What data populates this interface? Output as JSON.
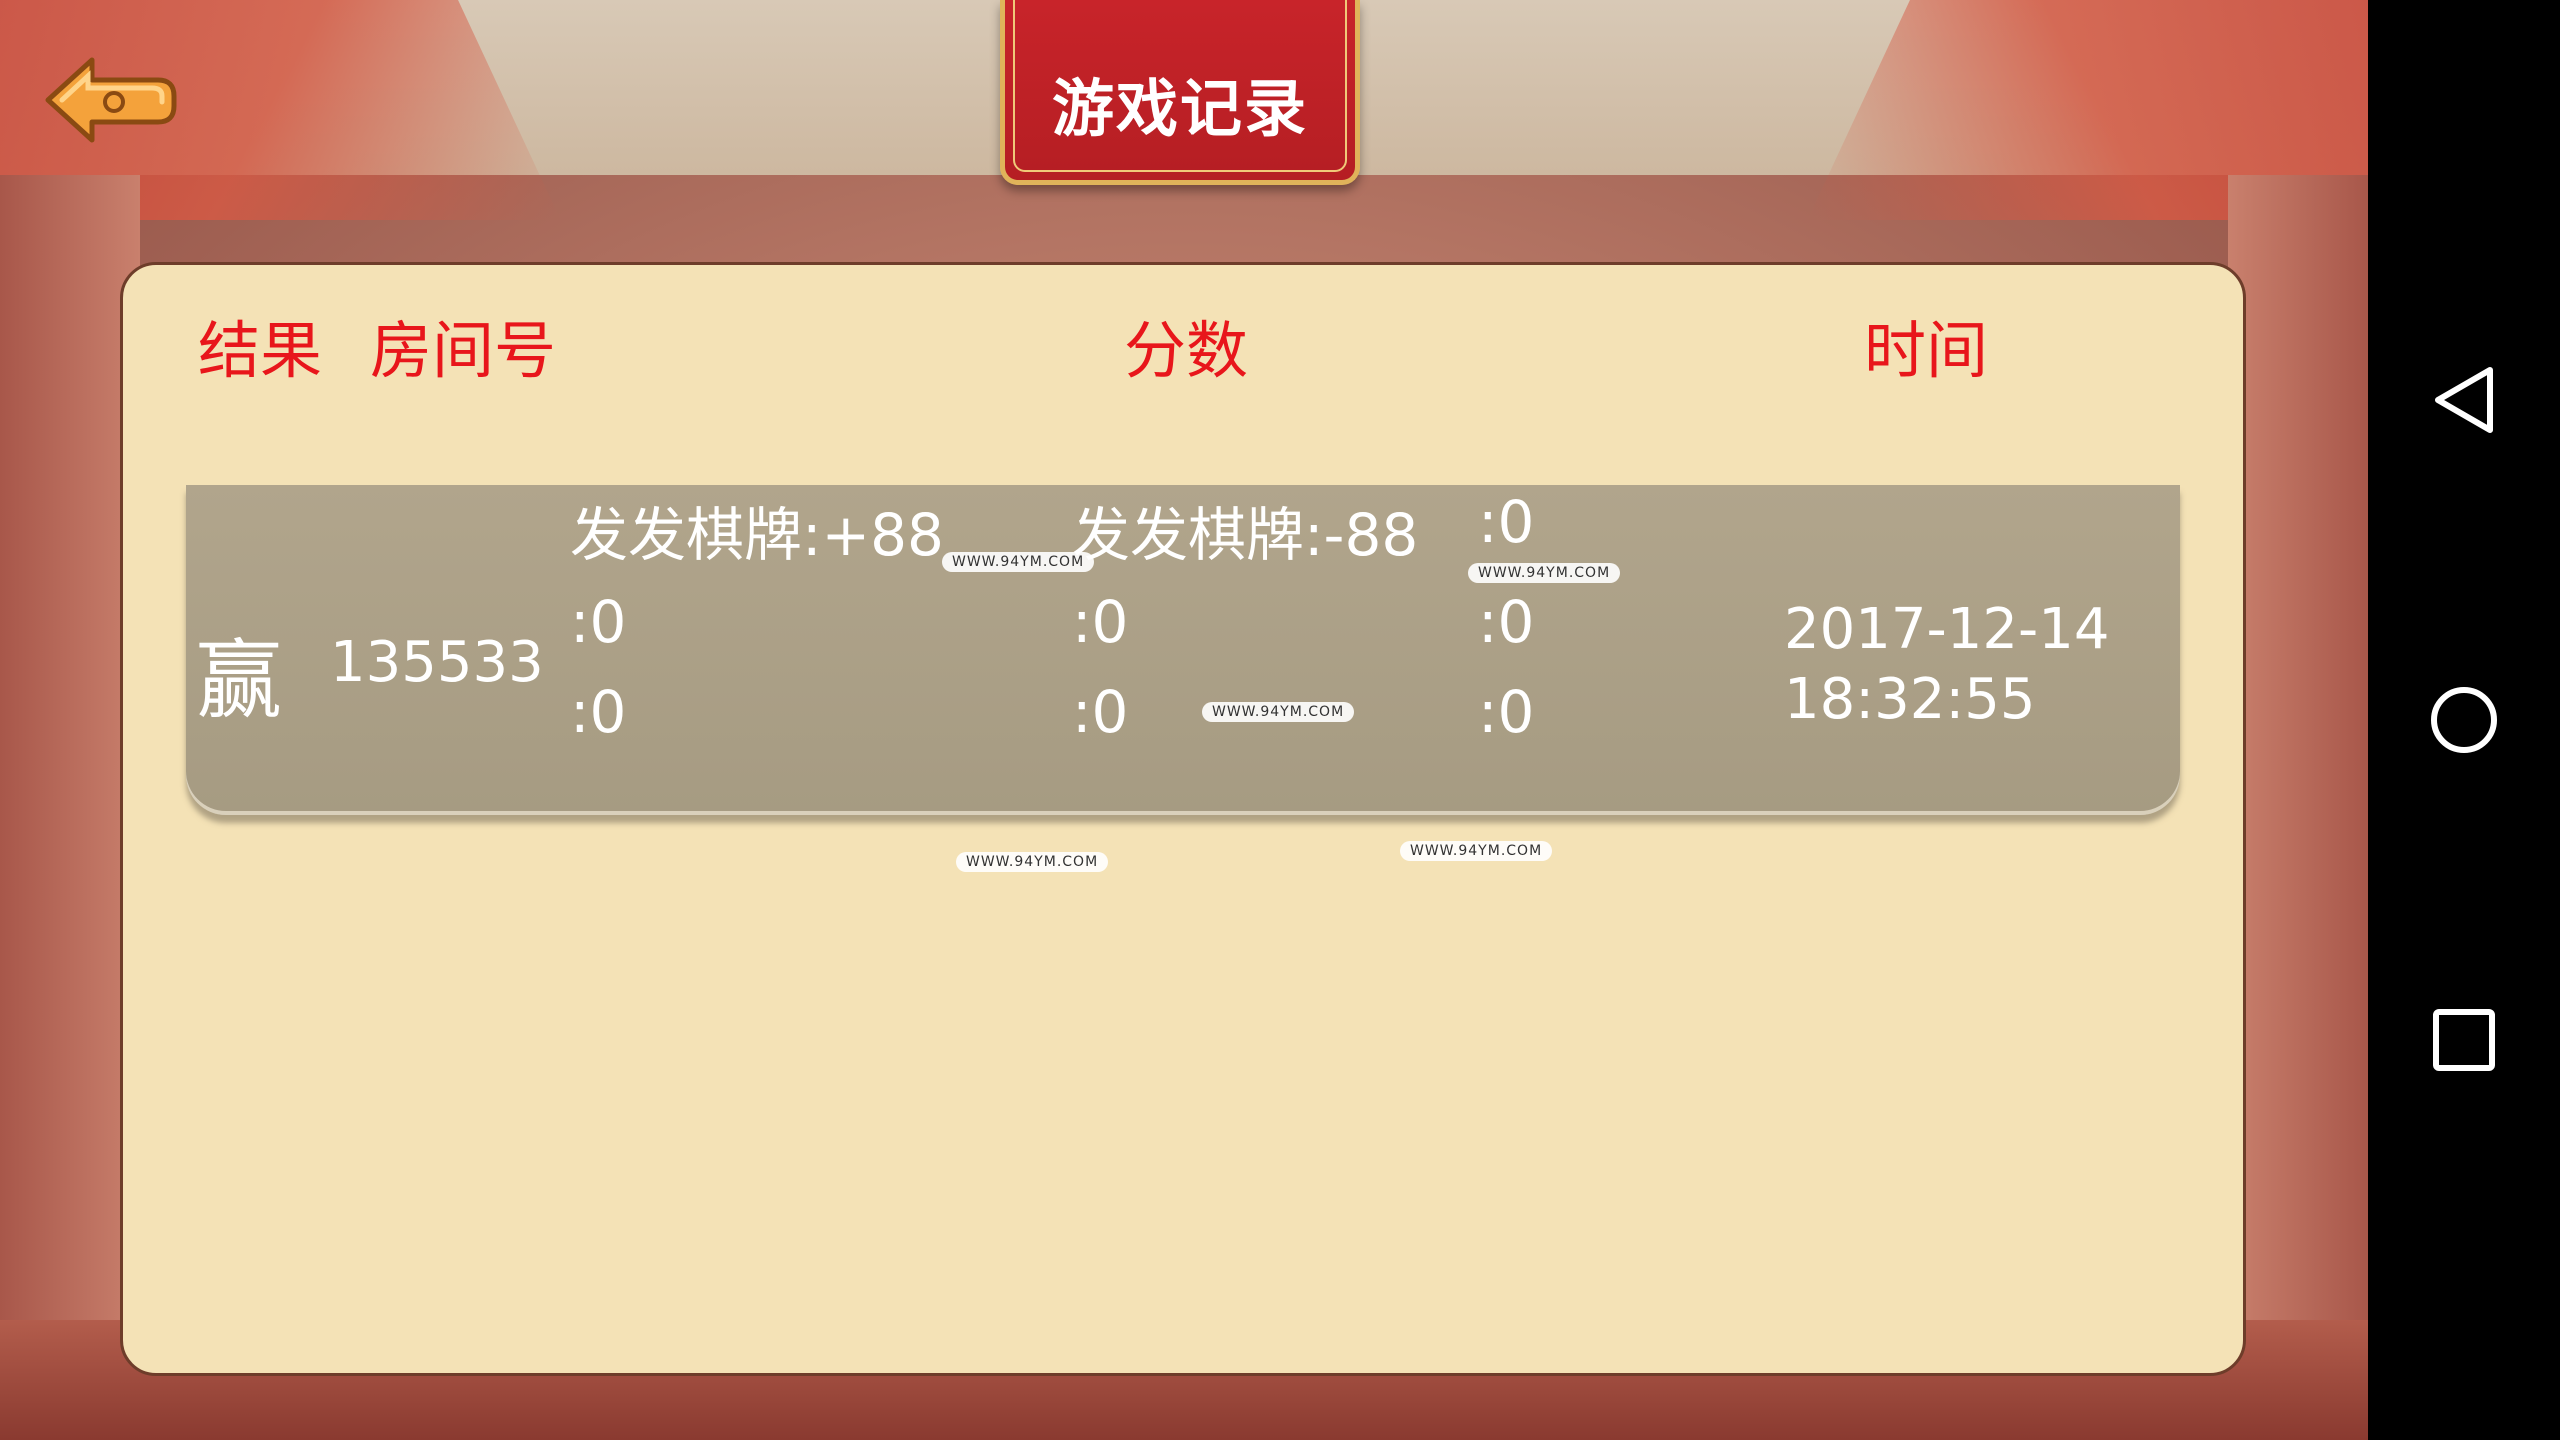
{
  "header": {
    "title": "游戏记录"
  },
  "columns": {
    "result": "结果",
    "room": "房间号",
    "score": "分数",
    "time": "时间"
  },
  "record": {
    "result": "赢",
    "room_id": "135533",
    "scores": [
      [
        "发发棋牌:+88",
        "发发棋牌:-88",
        ":0"
      ],
      [
        ":0",
        ":0",
        ":0"
      ],
      [
        ":0",
        ":0",
        ":0"
      ]
    ],
    "date": "2017-12-14",
    "time": "18:32:55"
  },
  "watermark": "WWW.94YM.COM",
  "icons": {
    "back": "back-arrow-icon",
    "nav_back": "triangle-back-icon",
    "nav_home": "circle-home-icon",
    "nav_recent": "square-recent-icon"
  },
  "colors": {
    "header_red": "#e8161b",
    "panel_bg": "#f4e2b6",
    "row_bg": "#a99e85",
    "banner_red": "#c8242a",
    "banner_gold": "#e0b35a"
  }
}
